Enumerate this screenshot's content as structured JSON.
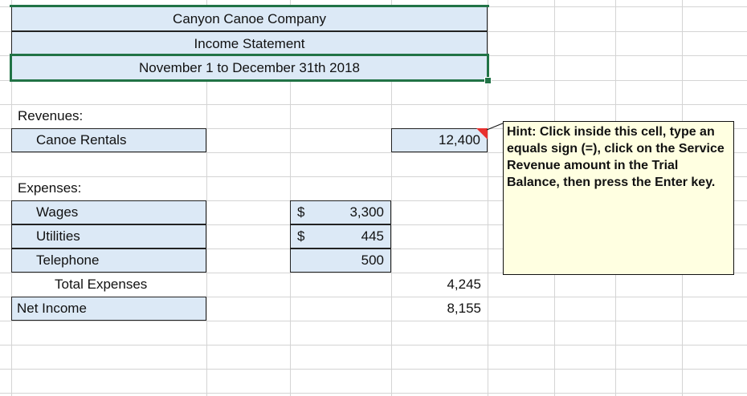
{
  "header": {
    "company": "Canyon Canoe Company",
    "statement": "Income Statement",
    "period": "November 1 to December 31th 2018"
  },
  "revenues": {
    "label": "Revenues:",
    "items": [
      {
        "label": "Canoe Rentals",
        "value": "12,400"
      }
    ]
  },
  "expenses": {
    "label": "Expenses:",
    "items": [
      {
        "label": "Wages",
        "currency": "$",
        "value": "3,300"
      },
      {
        "label": "Utilities",
        "currency": "$",
        "value": "445"
      },
      {
        "label": "Telephone",
        "currency": "",
        "value": "500"
      }
    ],
    "total_label": "Total Expenses",
    "total_value": "4,245"
  },
  "net_income": {
    "label": "Net Income",
    "value": "8,155"
  },
  "hint": {
    "text": "Hint: Click inside this cell, type an equals sign (=), click on the Service Revenue amount in the Trial Balance, then press the Enter key."
  },
  "colors": {
    "cell_fill": "#dce9f6",
    "selection": "#217346",
    "comment_marker": "#e8312f",
    "hint_fill": "#ffffe1",
    "gridline": "#d4d4d4"
  }
}
